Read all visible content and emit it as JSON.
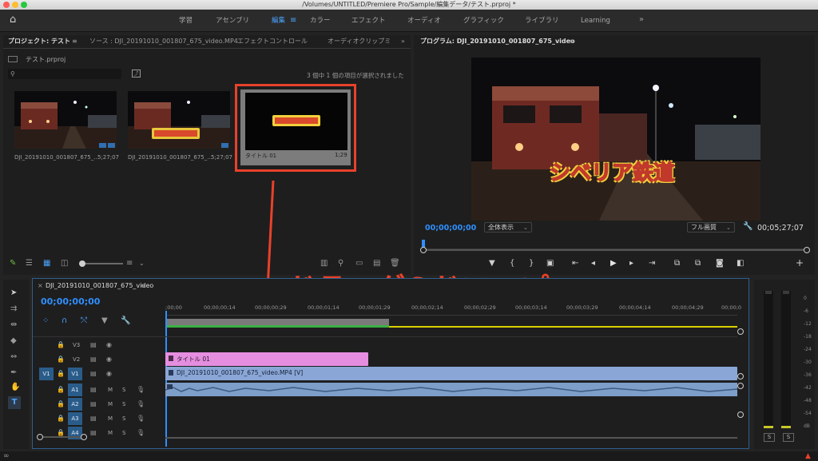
{
  "window": {
    "title": "/Volumes/UNTITLED/Premiere Pro/Sample/編集データ/テスト.prproj *"
  },
  "workspaces": [
    {
      "label": "学習"
    },
    {
      "label": "アセンブリ"
    },
    {
      "label": "編集"
    },
    {
      "label": "カラー"
    },
    {
      "label": "エフェクト"
    },
    {
      "label": "オーディオ"
    },
    {
      "label": "グラフィック"
    },
    {
      "label": "ライブラリ"
    },
    {
      "label": "Learning"
    }
  ],
  "project_panel": {
    "tabs": [
      "プロジェクト: テスト",
      "ソース : DJI_20191010_001807_675_video.MP4",
      "エフェクトコントロール",
      "オーディオクリップミ"
    ],
    "file": "テスト.prproj",
    "selection_status": "3 個中 1 個の項目が選択されました",
    "items": [
      {
        "name": "DJI_20191010_001807_675_...",
        "duration": "5;27;07"
      },
      {
        "name": "DJI_20191010_001807_675_...",
        "duration": "5;27;07"
      },
      {
        "name": "タイトル 01",
        "duration": "1;29"
      }
    ]
  },
  "program_monitor": {
    "title": "プログラム: DJI_20191010_001807_675_video",
    "overlay_title": "シベリア鉄道",
    "timecode_in": "00;00;00;00",
    "fit": "全体表示",
    "quality": "フル画質",
    "timecode_duration": "00;05;27;07"
  },
  "annotation": {
    "text": "ドラッグ&ドロップ"
  },
  "timeline": {
    "sequence_name": "DJI_20191010_001807_675_video",
    "timecode": "00;00;00;00",
    "ruler": [
      ";00;00",
      "00;00;00;14",
      "00;00;00;29",
      "00;00;01;14",
      "00;00;01;29",
      "00;00;02;14",
      "00;00;02;29",
      "00;00;03;14",
      "00;00;03;29",
      "00;00;04;14",
      "00;00;04;29",
      "00;00;0"
    ],
    "tracks": [
      {
        "name": "V3",
        "target": ""
      },
      {
        "name": "V2",
        "target": ""
      },
      {
        "name": "V1",
        "target": "V1"
      },
      {
        "name": "A1",
        "target": ""
      },
      {
        "name": "A2",
        "target": ""
      },
      {
        "name": "A3",
        "target": ""
      },
      {
        "name": "A4",
        "target": ""
      }
    ],
    "clips": {
      "title_clip": "タイトル 01",
      "video_clip": "DJI_20191010_001807_675_video.MP4 [V]"
    }
  },
  "audio_meter": {
    "labels": [
      "0",
      "-6",
      "-12",
      "-18",
      "-24",
      "-30",
      "-36",
      "-42",
      "-48",
      "-54",
      "dB"
    ],
    "solo": [
      "S",
      "S"
    ]
  },
  "colors": {
    "accent": "#2f8fff",
    "annotation": "#e8412b",
    "title_clip": "#e58ee0",
    "video_clip": "#8aa6d6",
    "audio_clip": "#7d9ec9"
  }
}
